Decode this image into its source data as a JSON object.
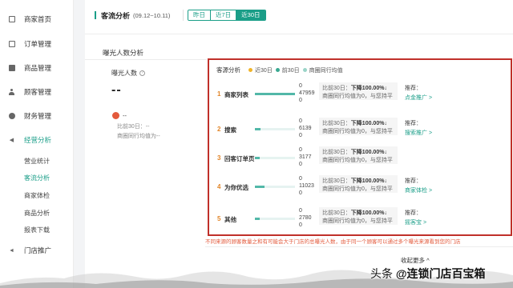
{
  "sidebar": {
    "items": [
      {
        "label": "商家首页",
        "icon": "home-icon"
      },
      {
        "label": "订单管理",
        "icon": "order-icon"
      },
      {
        "label": "商品管理",
        "icon": "goods-icon"
      },
      {
        "label": "顾客管理",
        "icon": "customer-icon"
      },
      {
        "label": "财务管理",
        "icon": "finance-icon"
      },
      {
        "label": "经营分析",
        "icon": "analysis-icon"
      },
      {
        "label": "门店推广",
        "icon": "promotion-icon"
      }
    ],
    "sub_items": [
      "营业统计",
      "客流分析",
      "商家体检",
      "商品分析",
      "报表下载"
    ]
  },
  "header": {
    "title": "客流分析",
    "range": "(09.12~10.11)",
    "periods": [
      "昨日",
      "近7日",
      "近30日"
    ]
  },
  "exposure": {
    "section_title": "曝光人数分析",
    "label": "曝光人数",
    "qmark": "?",
    "value": "--",
    "card_value": "--",
    "card_line1": "比前30日：--",
    "card_line2": "商圈同行均值为--"
  },
  "panel": {
    "legend_title": "客源分析",
    "legend": [
      {
        "label": "近30日",
        "color": "#f0b429"
      },
      {
        "label": "前30日",
        "color": "#3aa891"
      },
      {
        "label": "商圈同行均值",
        "color": "#9ad4c8"
      }
    ],
    "rows": [
      {
        "rank": "1",
        "name": "商家列表",
        "values": [
          "0",
          "47959",
          "0"
        ],
        "bar": 1.0,
        "cmp_line1": "比前30日：",
        "cmp_pct": "下降100.00%↓",
        "cmp_line2": "商圈同行均值为0，与您持平",
        "rec_label": "推荐：",
        "rec_link": "点金推广 >"
      },
      {
        "rank": "2",
        "name": "搜索",
        "values": [
          "0",
          "6139",
          "0"
        ],
        "bar": 0.13,
        "cmp_line1": "比前30日：",
        "cmp_pct": "下降100.00%↓",
        "cmp_line2": "商圈同行均值为0，与您持平",
        "rec_label": "推荐：",
        "rec_link": "搜索推广 >"
      },
      {
        "rank": "3",
        "name": "回客订单页",
        "values": [
          "0",
          "3177",
          "0"
        ],
        "bar": 0.07,
        "cmp_line1": "比前30日：",
        "cmp_pct": "下降100.00%↓",
        "cmp_line2": "商圈同行均值为0，与您持平",
        "rec_label": "",
        "rec_link": ""
      },
      {
        "rank": "4",
        "name": "为你优选",
        "values": [
          "0",
          "11023",
          "0"
        ],
        "bar": 0.23,
        "cmp_line1": "比前30日：",
        "cmp_pct": "下降100.00%↓",
        "cmp_line2": "商圈同行均值为0，与您持平",
        "rec_label": "推荐：",
        "rec_link": "商家体检 >"
      },
      {
        "rank": "5",
        "name": "其他",
        "values": [
          "0",
          "2780",
          "0"
        ],
        "bar": 0.06,
        "cmp_line1": "比前30日：",
        "cmp_pct": "下降100.00%↓",
        "cmp_line2": "商圈同行均值为0，与您持平",
        "rec_label": "推荐：",
        "rec_link": "摇客宝 >"
      }
    ]
  },
  "footnote": "不同来源的顾客数量之和有可能会大于门店的总曝光人数，由于同一个顾客可以通过多个曝光来源看到您的门店",
  "collapse_label": "收起更多 ^",
  "watermark": {
    "prefix": "头条",
    "handle": "@连锁门店百宝箱"
  }
}
